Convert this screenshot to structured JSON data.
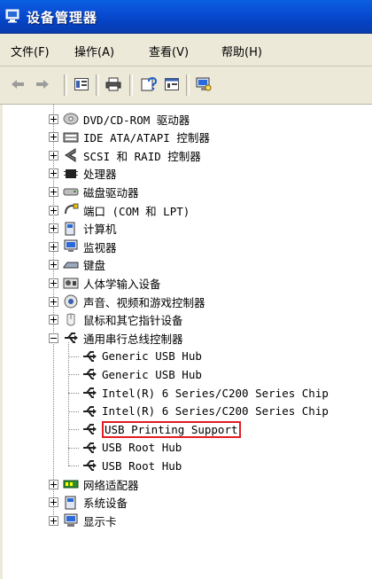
{
  "window": {
    "title": "设备管理器"
  },
  "menu": [
    "文件(F)",
    "操作(A)",
    "查看(V)",
    "帮助(H)"
  ],
  "tree": [
    {
      "label": "DVD/CD-ROM 驱动器",
      "icon": "dvd-drive-icon",
      "expanded": false
    },
    {
      "label": "IDE ATA/ATAPI 控制器",
      "icon": "ide-controller-icon",
      "expanded": false
    },
    {
      "label": "SCSI 和 RAID 控制器",
      "icon": "scsi-controller-icon",
      "expanded": false
    },
    {
      "label": "处理器",
      "icon": "processor-icon",
      "expanded": false
    },
    {
      "label": "磁盘驱动器",
      "icon": "disk-drive-icon",
      "expanded": false
    },
    {
      "label": "端口 (COM 和 LPT)",
      "icon": "port-icon",
      "expanded": false
    },
    {
      "label": "计算机",
      "icon": "computer-icon",
      "expanded": false
    },
    {
      "label": "监视器",
      "icon": "monitor-icon",
      "expanded": false
    },
    {
      "label": "键盘",
      "icon": "keyboard-icon",
      "expanded": false
    },
    {
      "label": "人体学输入设备",
      "icon": "hid-icon",
      "expanded": false
    },
    {
      "label": "声音、视频和游戏控制器",
      "icon": "sound-icon",
      "expanded": false
    },
    {
      "label": "鼠标和其它指针设备",
      "icon": "mouse-icon",
      "expanded": false
    },
    {
      "label": "通用串行总线控制器",
      "icon": "usb-icon",
      "expanded": true,
      "children": [
        {
          "label": "Generic USB Hub",
          "icon": "usb-icon"
        },
        {
          "label": "Generic USB Hub",
          "icon": "usb-icon"
        },
        {
          "label": "Intel(R) 6 Series/C200 Series Chip",
          "icon": "usb-icon"
        },
        {
          "label": "Intel(R) 6 Series/C200 Series Chip",
          "icon": "usb-icon"
        },
        {
          "label": "USB Printing Support",
          "icon": "usb-icon",
          "highlighted": true
        },
        {
          "label": "USB Root Hub",
          "icon": "usb-icon"
        },
        {
          "label": "USB Root Hub",
          "icon": "usb-icon"
        }
      ]
    },
    {
      "label": "网络适配器",
      "icon": "network-adapter-icon",
      "expanded": false
    },
    {
      "label": "系统设备",
      "icon": "system-device-icon",
      "expanded": false
    },
    {
      "label": "显示卡",
      "icon": "display-adapter-icon",
      "expanded": false
    }
  ],
  "colors": {
    "titlebar": "#0a4fd6",
    "chrome": "#ece9d8",
    "highlight_box": "#e31b23"
  }
}
